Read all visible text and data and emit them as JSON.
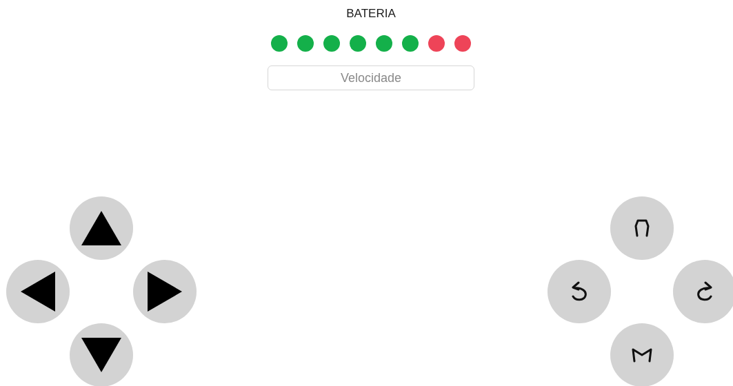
{
  "battery": {
    "title": "BATERIA",
    "dots": [
      {
        "color": "#14b04a"
      },
      {
        "color": "#14b04a"
      },
      {
        "color": "#14b04a"
      },
      {
        "color": "#14b04a"
      },
      {
        "color": "#14b04a"
      },
      {
        "color": "#14b04a"
      },
      {
        "color": "#ee4458"
      },
      {
        "color": "#ee4458"
      }
    ]
  },
  "speed_field": {
    "placeholder": "Velocidade"
  },
  "direction_pad": [
    {
      "kind": "up"
    },
    {
      "kind": "left"
    },
    {
      "kind": "right"
    },
    {
      "kind": "down"
    }
  ],
  "action_pad": [
    {
      "kind": "arch"
    },
    {
      "kind": "rotate-left"
    },
    {
      "kind": "rotate-right"
    },
    {
      "kind": "claw"
    }
  ]
}
